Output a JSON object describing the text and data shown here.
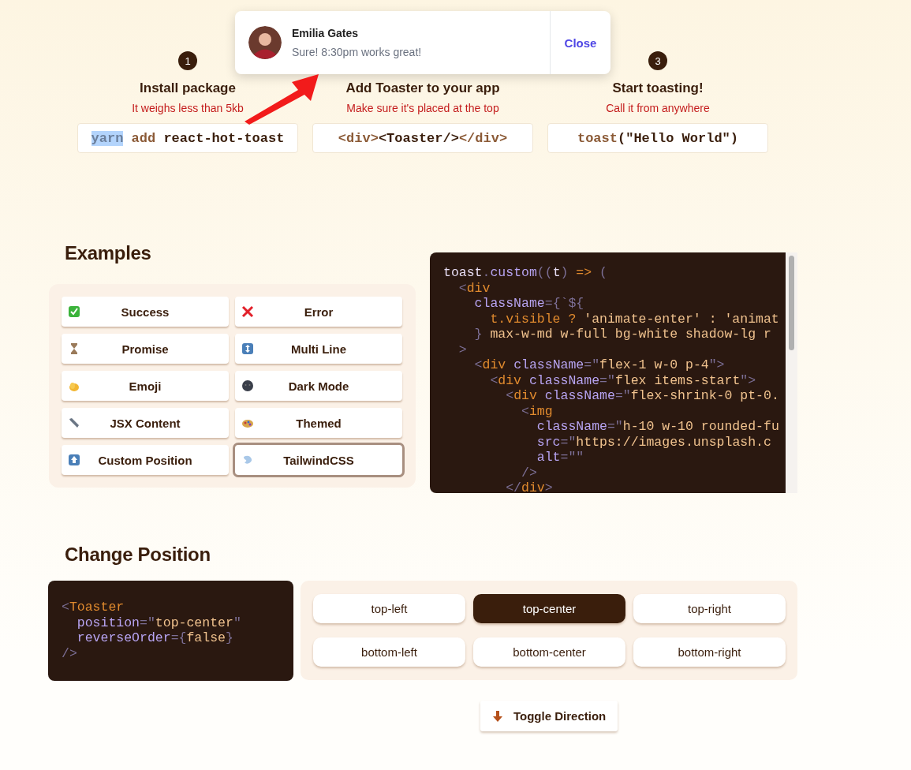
{
  "toast": {
    "name": "Emilia Gates",
    "message": "Sure! 8:30pm works great!",
    "action": "Close"
  },
  "steps": [
    {
      "number": "1",
      "title": "Install package",
      "subtitle": "It weighs less than 5kb",
      "code": [
        {
          "t": "yarn",
          "kind": "kw",
          "highlighted": true
        },
        {
          "t": " add ",
          "kind": "kw",
          "highlighted": false
        },
        {
          "t": "react-hot-toast",
          "kind": "plain",
          "highlighted": false
        }
      ]
    },
    {
      "title": "Add Toaster to your app",
      "subtitle": "Make sure it's placed at the top",
      "code": [
        {
          "t": "<div>",
          "kind": "kw",
          "highlighted": false
        },
        {
          "t": "<Toaster/>",
          "kind": "plain",
          "highlighted": false
        },
        {
          "t": "</div>",
          "kind": "kw",
          "highlighted": false
        }
      ]
    },
    {
      "number": "3",
      "title": "Start toasting!",
      "subtitle": "Call it from anywhere",
      "code": [
        {
          "t": "toast",
          "kind": "kw",
          "highlighted": false
        },
        {
          "t": "(\"Hello World\")",
          "kind": "plain",
          "highlighted": false
        }
      ]
    }
  ],
  "examples": {
    "title": "Examples",
    "buttons": [
      {
        "label": "Success",
        "selected": false
      },
      {
        "label": "Error",
        "selected": false
      },
      {
        "label": "Promise",
        "selected": false
      },
      {
        "label": "Multi Line",
        "selected": false
      },
      {
        "label": "Emoji",
        "selected": false
      },
      {
        "label": "Dark Mode",
        "selected": false
      },
      {
        "label": "JSX Content",
        "selected": false
      },
      {
        "label": "Themed",
        "selected": false
      },
      {
        "label": "Custom Position",
        "selected": false
      },
      {
        "label": "TailwindCSS",
        "selected": true
      }
    ],
    "code": [
      [
        {
          "t": "toast",
          "kind": "plain"
        },
        {
          "t": ".",
          "kind": "punct"
        },
        {
          "t": "custom",
          "kind": "attr"
        },
        {
          "t": "((",
          "kind": "punct"
        },
        {
          "t": "t",
          "kind": "plain"
        },
        {
          "t": ")",
          "kind": "punct"
        },
        {
          "t": " =>",
          "kind": "tag"
        },
        {
          "t": " (",
          "kind": "punct"
        }
      ],
      [
        {
          "t": "  <",
          "kind": "punct"
        },
        {
          "t": "div",
          "kind": "tag"
        }
      ],
      [
        {
          "t": "    className",
          "kind": "attr"
        },
        {
          "t": "={`${",
          "kind": "punct"
        }
      ],
      [
        {
          "t": "      t.visible ? ",
          "kind": "tag"
        },
        {
          "t": "'animate-enter' : 'animat",
          "kind": "string"
        }
      ],
      [
        {
          "t": "    }",
          "kind": "punct"
        },
        {
          "t": " max-w-md w-full bg-white shadow-lg r",
          "kind": "string"
        }
      ],
      [
        {
          "t": "  >",
          "kind": "punct"
        }
      ],
      [
        {
          "t": "    <",
          "kind": "punct"
        },
        {
          "t": "div",
          "kind": "tag"
        },
        {
          "t": " className",
          "kind": "attr"
        },
        {
          "t": "=\"",
          "kind": "punct"
        },
        {
          "t": "flex-1 w-0 p-4",
          "kind": "string"
        },
        {
          "t": "\">",
          "kind": "punct"
        }
      ],
      [
        {
          "t": "      <",
          "kind": "punct"
        },
        {
          "t": "div",
          "kind": "tag"
        },
        {
          "t": " className",
          "kind": "attr"
        },
        {
          "t": "=\"",
          "kind": "punct"
        },
        {
          "t": "flex items-start",
          "kind": "string"
        },
        {
          "t": "\">",
          "kind": "punct"
        }
      ],
      [
        {
          "t": "        <",
          "kind": "punct"
        },
        {
          "t": "div",
          "kind": "tag"
        },
        {
          "t": " className",
          "kind": "attr"
        },
        {
          "t": "=\"",
          "kind": "punct"
        },
        {
          "t": "flex-shrink-0 pt-0.",
          "kind": "string"
        }
      ],
      [
        {
          "t": "          <",
          "kind": "punct"
        },
        {
          "t": "img",
          "kind": "tag"
        }
      ],
      [
        {
          "t": "            className",
          "kind": "attr"
        },
        {
          "t": "=\"",
          "kind": "punct"
        },
        {
          "t": "h-10 w-10 rounded-fu",
          "kind": "string"
        }
      ],
      [
        {
          "t": "            src",
          "kind": "attr"
        },
        {
          "t": "=\"",
          "kind": "punct"
        },
        {
          "t": "https://images.unsplash.c",
          "kind": "string"
        }
      ],
      [
        {
          "t": "            alt",
          "kind": "attr"
        },
        {
          "t": "=\"\"",
          "kind": "punct"
        }
      ],
      [
        {
          "t": "          />",
          "kind": "punct"
        }
      ],
      [
        {
          "t": "        </",
          "kind": "punct"
        },
        {
          "t": "div",
          "kind": "tag"
        },
        {
          "t": ">",
          "kind": "punct"
        }
      ]
    ]
  },
  "position": {
    "title": "Change Position",
    "code": [
      [
        {
          "t": "<",
          "kind": "punct"
        },
        {
          "t": "Toaster",
          "kind": "tag"
        }
      ],
      [
        {
          "t": "  position",
          "kind": "attr"
        },
        {
          "t": "=\"",
          "kind": "punct"
        },
        {
          "t": "top-center",
          "kind": "string"
        },
        {
          "t": "\"",
          "kind": "punct"
        }
      ],
      [
        {
          "t": "  reverseOrder",
          "kind": "attr"
        },
        {
          "t": "={",
          "kind": "punct"
        },
        {
          "t": "false",
          "kind": "string"
        },
        {
          "t": "}",
          "kind": "punct"
        }
      ],
      [
        {
          "t": "/>",
          "kind": "punct"
        }
      ]
    ],
    "options": [
      {
        "label": "top-left",
        "selected": false
      },
      {
        "label": "top-center",
        "selected": true
      },
      {
        "label": "top-right",
        "selected": false
      },
      {
        "label": "bottom-left",
        "selected": false
      },
      {
        "label": "bottom-center",
        "selected": false
      },
      {
        "label": "bottom-right",
        "selected": false
      }
    ],
    "toggle": "Toggle Direction"
  }
}
